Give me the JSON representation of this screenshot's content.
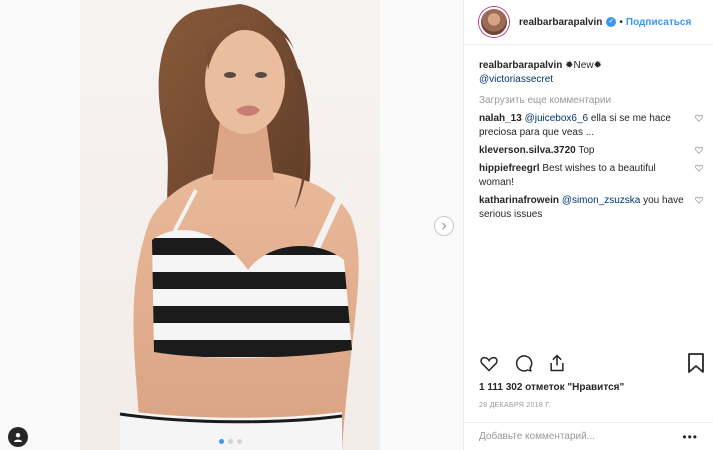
{
  "header": {
    "username": "realbarbarapalvin",
    "separator": "•",
    "follow_label": "Подписаться",
    "verified_icon": "verified-badge-icon"
  },
  "caption": {
    "username": "realbarbarapalvin",
    "text": "✹New✹",
    "mention": "@victoriassecret"
  },
  "load_more_label": "Загрузить еще комментарии",
  "comments": [
    {
      "user": "nalah_13",
      "mention": "@juicebox6_6",
      "text": " ella si se me hace preciosa para que veas ..."
    },
    {
      "user": "kleverson.silva.3720",
      "mention": "",
      "text": " Top"
    },
    {
      "user": "hippiefreegrl",
      "mention": "",
      "text": " Best wishes to a beautiful woman!"
    },
    {
      "user": "katharinafrowein",
      "mention": "@simon_zsuzska",
      "text": " you have serious issues"
    }
  ],
  "likes_text": "1 111 302 отметок \"Нравится\"",
  "date": "28 ДЕКАБРЯ 2018 Г.",
  "add_comment_placeholder": "Добавьте комментарий...",
  "more_label": "•••",
  "photo": {
    "carousel_count": 3,
    "active_index": 0,
    "description_icon": "photo-of-woman-in-striped-bra"
  },
  "colors": {
    "accent": "#3897f0",
    "text": "#262626",
    "muted": "#999999",
    "mention": "#003569"
  }
}
